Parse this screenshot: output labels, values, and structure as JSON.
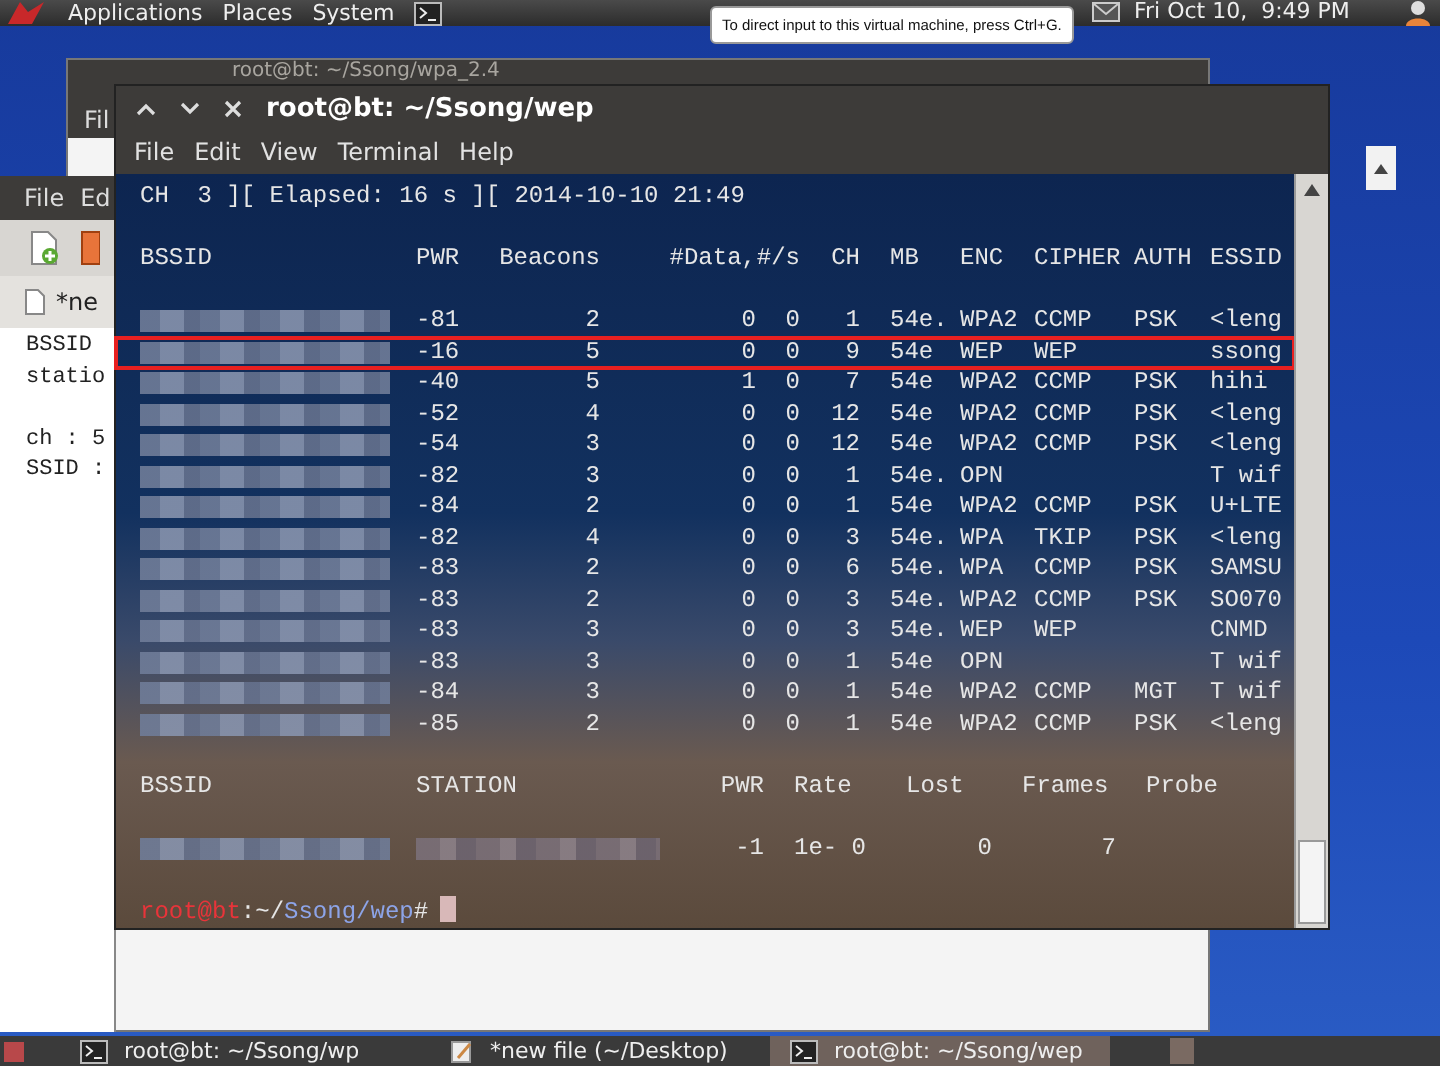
{
  "top_panel": {
    "menus": [
      "Applications",
      "Places",
      "System"
    ],
    "clock": "Fri Oct 10,  9:49 PM"
  },
  "tooltip": "To direct input to this virtual machine, press Ctrl+G.",
  "back_window": {
    "title": "root@bt: ~/Ssong/wpa_2.4",
    "menu": "Fil"
  },
  "editor_window": {
    "menus": [
      "File",
      "Ed"
    ],
    "tab": "*ne",
    "paragraphs": [
      [
        "BSSID",
        "statio"
      ],
      [
        "ch : 5",
        "SSID :"
      ]
    ]
  },
  "terminal": {
    "title": "root@bt: ~/Ssong/wep",
    "menus": [
      "File",
      "Edit",
      "View",
      "Terminal",
      "Help"
    ],
    "status_line": "CH  3 ][ Elapsed: 16 s ][ 2014-10-10 21:49",
    "ap_columns": [
      "BSSID",
      "PWR",
      "Beacons",
      "#Data,",
      "#/s",
      "CH",
      "MB",
      "ENC",
      "CIPHER",
      "AUTH",
      "ESSID"
    ],
    "aps": [
      {
        "pwr": "-81",
        "beacons": "2",
        "data": "0",
        "per_s": "0",
        "ch": "1",
        "mb": "54e.",
        "enc": "WPA2",
        "cipher": "CCMP",
        "auth": "PSK",
        "essid": "<leng",
        "highlighted": false
      },
      {
        "pwr": "-16",
        "beacons": "5",
        "data": "0",
        "per_s": "0",
        "ch": "9",
        "mb": "54e",
        "enc": "WEP",
        "cipher": "WEP",
        "essid": "ssong",
        "highlighted": true
      },
      {
        "pwr": "-40",
        "beacons": "5",
        "data": "1",
        "per_s": "0",
        "ch": "7",
        "mb": "54e",
        "enc": "WPA2",
        "cipher": "CCMP",
        "auth": "PSK",
        "essid": "hihi",
        "highlighted": false
      },
      {
        "pwr": "-52",
        "beacons": "4",
        "data": "0",
        "per_s": "0",
        "ch": "12",
        "mb": "54e",
        "enc": "WPA2",
        "cipher": "CCMP",
        "auth": "PSK",
        "essid": "<leng",
        "highlighted": false
      },
      {
        "pwr": "-54",
        "beacons": "3",
        "data": "0",
        "per_s": "0",
        "ch": "12",
        "mb": "54e",
        "enc": "WPA2",
        "cipher": "CCMP",
        "auth": "PSK",
        "essid": "<leng",
        "highlighted": false
      },
      {
        "pwr": "-82",
        "beacons": "3",
        "data": "0",
        "per_s": "0",
        "ch": "1",
        "mb": "54e.",
        "enc": "OPN",
        "essid": "T wif",
        "highlighted": false
      },
      {
        "pwr": "-84",
        "beacons": "2",
        "data": "0",
        "per_s": "0",
        "ch": "1",
        "mb": "54e",
        "enc": "WPA2",
        "cipher": "CCMP",
        "auth": "PSK",
        "essid": "U+LTE",
        "highlighted": false
      },
      {
        "pwr": "-82",
        "beacons": "4",
        "data": "0",
        "per_s": "0",
        "ch": "3",
        "mb": "54e.",
        "enc": "WPA",
        "cipher": "TKIP",
        "auth": "PSK",
        "essid": "<leng",
        "highlighted": false
      },
      {
        "pwr": "-83",
        "beacons": "2",
        "data": "0",
        "per_s": "0",
        "ch": "6",
        "mb": "54e.",
        "enc": "WPA",
        "cipher": "CCMP",
        "auth": "PSK",
        "essid": "SAMSU",
        "highlighted": false
      },
      {
        "pwr": "-83",
        "beacons": "2",
        "data": "0",
        "per_s": "0",
        "ch": "3",
        "mb": "54e.",
        "enc": "WPA2",
        "cipher": "CCMP",
        "auth": "PSK",
        "essid": "SO070",
        "highlighted": false
      },
      {
        "pwr": "-83",
        "beacons": "3",
        "data": "0",
        "per_s": "0",
        "ch": "3",
        "mb": "54e.",
        "enc": "WEP",
        "cipher": "WEP",
        "essid": "CNMD",
        "highlighted": false
      },
      {
        "pwr": "-83",
        "beacons": "3",
        "data": "0",
        "per_s": "0",
        "ch": "1",
        "mb": "54e",
        "enc": "OPN",
        "essid": "T wif",
        "highlighted": false
      },
      {
        "pwr": "-84",
        "beacons": "3",
        "data": "0",
        "per_s": "0",
        "ch": "1",
        "mb": "54e",
        "enc": "WPA2",
        "cipher": "CCMP",
        "auth": "MGT",
        "essid": "T wif",
        "highlighted": false
      },
      {
        "pwr": "-85",
        "beacons": "2",
        "data": "0",
        "per_s": "0",
        "ch": "1",
        "mb": "54e",
        "enc": "WPA2",
        "cipher": "CCMP",
        "auth": "PSK",
        "essid": "<leng",
        "highlighted": false
      }
    ],
    "station_columns": [
      "BSSID",
      "STATION",
      "PWR",
      "Rate",
      "Lost",
      "Frames",
      "Probe"
    ],
    "stations": [
      {
        "pwr": "-1",
        "rate": "1e- 0",
        "lost": "0",
        "frames": "7"
      }
    ],
    "prompt": {
      "user": "root@bt",
      "sep": ":~/",
      "dir": "Ssong/wep",
      "symbol": "#"
    }
  },
  "taskbar": [
    {
      "label": "root@bt: ~/Ssong/wp",
      "kind": "terminal",
      "selected": false
    },
    {
      "label": "*new file (~/Desktop)",
      "kind": "editor",
      "selected": false
    },
    {
      "label": "root@bt: ~/Ssong/wep",
      "kind": "terminal",
      "selected": true
    }
  ]
}
